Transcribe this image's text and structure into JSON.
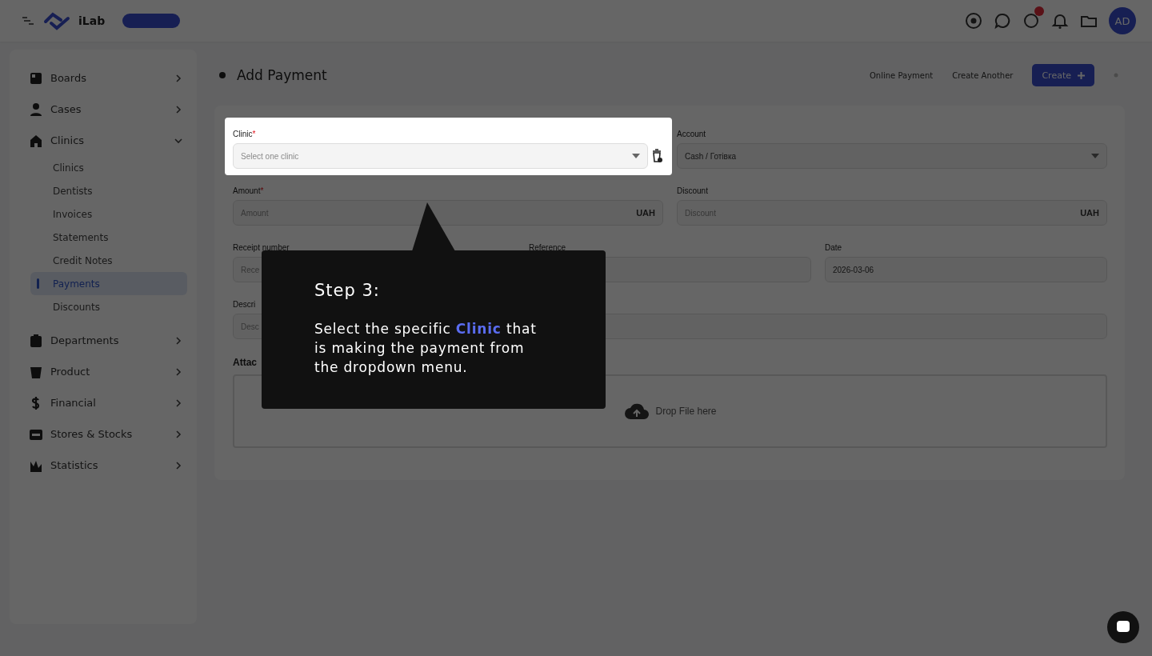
{
  "topbar": {
    "brand": "iLab",
    "avatar": "AD",
    "notification_dot": true
  },
  "sidebar": {
    "items": [
      {
        "label": "Boards",
        "expanded": false
      },
      {
        "label": "Cases",
        "expanded": false
      },
      {
        "label": "Clinics",
        "expanded": true,
        "children": [
          {
            "label": "Clinics",
            "selected": false
          },
          {
            "label": "Dentists",
            "selected": false
          },
          {
            "label": "Invoices",
            "selected": false
          },
          {
            "label": "Statements",
            "selected": false
          },
          {
            "label": "Credit Notes",
            "selected": false
          },
          {
            "label": "Payments",
            "selected": true
          },
          {
            "label": "Discounts",
            "selected": false
          }
        ]
      },
      {
        "label": "Departments",
        "expanded": false
      },
      {
        "label": "Product",
        "expanded": false
      },
      {
        "label": "Financial",
        "expanded": false
      },
      {
        "label": "Stores & Stocks",
        "expanded": false
      },
      {
        "label": "Statistics",
        "expanded": false
      }
    ]
  },
  "page": {
    "title": "Add Payment",
    "options": [
      "Online Payment",
      "Create Another"
    ],
    "create_button": "Create"
  },
  "form": {
    "required_mark": "*",
    "fields": [
      {
        "kind": "select",
        "label": "Clinic",
        "required": true,
        "placeholder": "Select one clinic",
        "highlighted": true
      },
      {
        "kind": "select",
        "label": "Account",
        "required": false,
        "value": "Cash / Готівка",
        "highlighted": false
      },
      {
        "kind": "money",
        "label": "Amount",
        "required": true,
        "placeholder": "Amount",
        "unit": "UAH",
        "highlighted": false
      },
      {
        "kind": "money",
        "label": "Discount",
        "required": false,
        "placeholder": "Discount",
        "unit": "UAH",
        "highlighted": false
      },
      {
        "kind": "text",
        "label": "Receipt number",
        "required": false,
        "placeholder": "Rece",
        "highlighted": false
      },
      {
        "kind": "text",
        "label": "Reference",
        "required": false,
        "highlighted": false
      },
      {
        "kind": "text",
        "label": "Date",
        "required": false,
        "value": "2026-03-06",
        "highlighted": false
      },
      {
        "kind": "text",
        "label": "Descri",
        "required": false,
        "placeholder": "Desc",
        "highlighted": false
      }
    ],
    "attachments_label": "Attac",
    "dropzone_text": "Drop File here"
  },
  "tooltip": {
    "title": "Step 3:",
    "text": "Select the specific **Clinic** that is making the payment from the dropdown menu."
  }
}
